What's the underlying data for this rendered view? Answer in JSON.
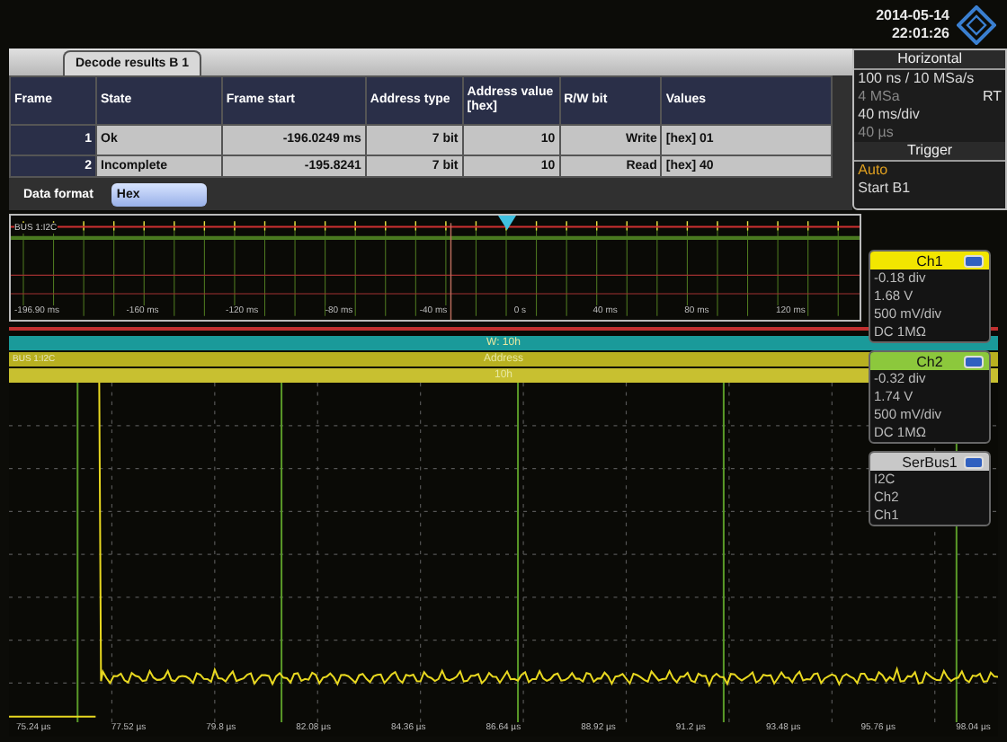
{
  "header": {
    "date": "2014-05-14",
    "time": "22:01:26"
  },
  "decode_results": {
    "tab": "Decode results B 1",
    "columns": [
      "Frame",
      "State",
      "Frame start",
      "Address type",
      "Address value [hex]",
      "R/W bit",
      "Values"
    ],
    "rows": [
      {
        "cells": [
          "1",
          "Ok",
          "-196.0249 ms",
          "7 bit",
          "10",
          "Write",
          "[hex] 01"
        ]
      },
      {
        "cells": [
          "2",
          "Incomplete",
          "-195.8241",
          "7 bit",
          "10",
          "Read",
          "[hex] 40"
        ]
      }
    ],
    "data_format": {
      "label": "Data format",
      "value": "Hex"
    }
  },
  "horizontal": {
    "title": "Horizontal",
    "lines": [
      {
        "text": "100 ns / 10 MSa/s",
        "disabled": false
      },
      {
        "text": "4 MSa",
        "disabled": true
      },
      {
        "text": "40 ms/div",
        "disabled": false
      },
      {
        "text": "40 µs",
        "disabled": true
      }
    ],
    "mode": "RT"
  },
  "trigger": {
    "title": "Trigger",
    "mode": "Auto",
    "source": "Start B1"
  },
  "zoom_view": {
    "bus_label": "BUS 1:I2C",
    "time_labels": [
      "-196.90 ms",
      "-160 ms",
      "-120 ms",
      "-80 ms",
      "-40 ms",
      "0 s",
      "40 ms",
      "80 ms",
      "120 ms"
    ]
  },
  "main_view": {
    "decode_bars": [
      {
        "text": "W: 10h",
        "color": "#1a9a9a"
      },
      {
        "text": "Address",
        "color": "#b8b020"
      },
      {
        "text": "10h",
        "color": "#c8c030"
      }
    ],
    "bus_label": "BUS 1:I2C",
    "time_labels": [
      "75.24 µs",
      "77.52 µs",
      "79.8 µs",
      "82.08 µs",
      "84.36 µs",
      "86.64 µs",
      "88.92 µs",
      "91.2 µs",
      "93.48 µs",
      "95.76 µs",
      "98.04 µs"
    ]
  },
  "channels": [
    {
      "name": "Ch1",
      "color": "#f2e600",
      "lines": [
        "-0.18 div",
        "1.68 V",
        "500 mV/div",
        "DC 1MΩ"
      ]
    },
    {
      "name": "Ch2",
      "color": "#8cc83c",
      "lines": [
        "-0.32 div",
        "1.74 V",
        "500 mV/div",
        "DC 1MΩ"
      ]
    },
    {
      "name": "SerBus1",
      "color": "#c8c8c8",
      "lines": [
        "I2C",
        "Ch2",
        "Ch1"
      ]
    }
  ]
}
